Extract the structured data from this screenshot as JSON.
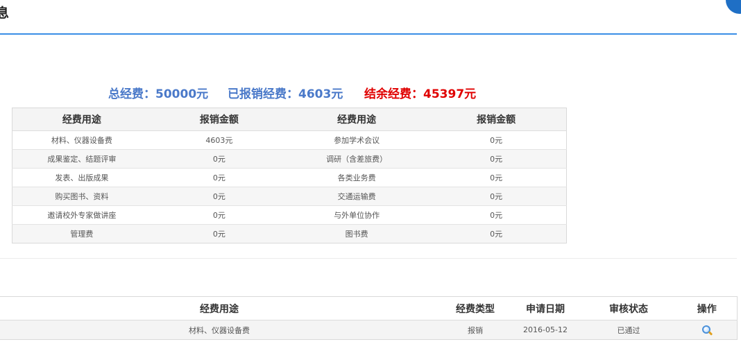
{
  "header": {
    "title": "息"
  },
  "summary": {
    "total": "总经费：50000元",
    "reimbursed": "已报销经费：4603元",
    "balance": "结余经费：45397元",
    "colors": {
      "total": "#4a79c9",
      "reimbursed": "#4a79c9",
      "balance": "#e00000"
    }
  },
  "budget_table": {
    "headers": [
      "经费用途",
      "报销金额",
      "经费用途",
      "报销金额"
    ],
    "rows": [
      [
        "材料、仪器设备费",
        "4603元",
        "参加学术会议",
        "0元"
      ],
      [
        "成果鉴定、结题评审",
        "0元",
        "调研（含差旅费）",
        "0元"
      ],
      [
        "发表、出版成果",
        "0元",
        "各类业务费",
        "0元"
      ],
      [
        "购买图书、资料",
        "0元",
        "交通运输费",
        "0元"
      ],
      [
        "邀请校外专家做讲座",
        "0元",
        "与外单位协作",
        "0元"
      ],
      [
        "管理费",
        "0元",
        "图书费",
        "0元"
      ]
    ]
  },
  "records_table": {
    "headers": [
      "经费用途",
      "经费类型",
      "申请日期",
      "审核状态",
      "操作"
    ],
    "rows": [
      {
        "purpose": "材料、仪器设备费",
        "type": "报销",
        "date": "2016-05-12",
        "status": "已通过",
        "action_icon": "magnifier-icon"
      }
    ]
  },
  "theme": {
    "accent": "#3a8ee6"
  }
}
